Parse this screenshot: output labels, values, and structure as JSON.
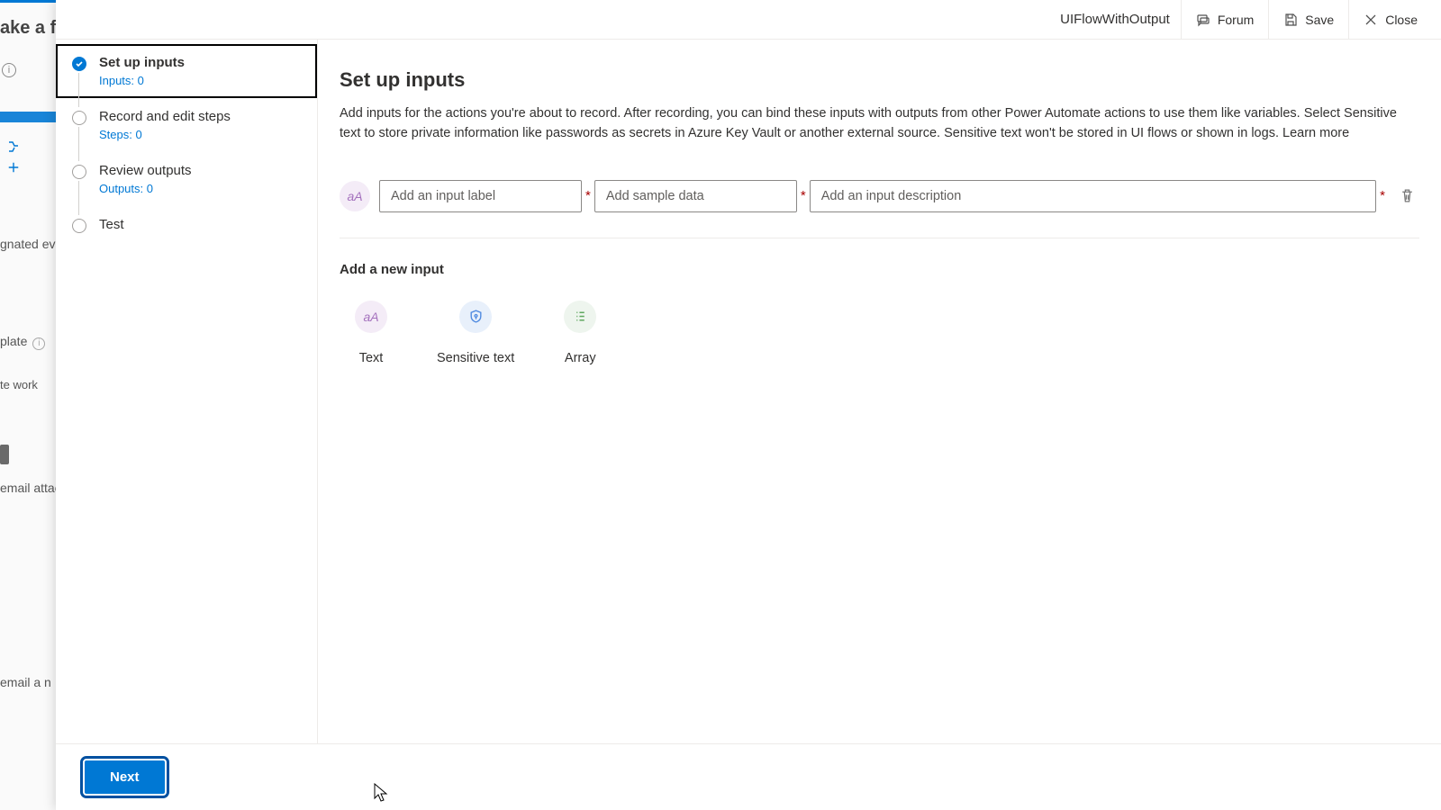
{
  "background": {
    "heading": "ake a fl",
    "items": {
      "gnated": "gnated even",
      "plate": "plate",
      "work": "te work",
      "attach": "email attac",
      "emailn": "email a n"
    }
  },
  "header": {
    "flow_name": "UIFlowWithOutput",
    "forum": "Forum",
    "save": "Save",
    "close": "Close"
  },
  "wizard": {
    "steps": [
      {
        "label": "Set up inputs",
        "sub": "Inputs: 0"
      },
      {
        "label": "Record and edit steps",
        "sub": "Steps: 0"
      },
      {
        "label": "Review outputs",
        "sub": "Outputs: 0"
      },
      {
        "label": "Test",
        "sub": ""
      }
    ]
  },
  "panel": {
    "title": "Set up inputs",
    "description": "Add inputs for the actions you're about to record. After recording, you can bind these inputs with outputs from other Power Automate actions to use them like variables. Select Sensitive text to store private information like passwords as secrets in Azure Key Vault or another external source. Sensitive text won't be stored in UI flows or shown in logs. ",
    "learn_more": "Learn more",
    "input_row": {
      "label_ph": "Add an input label",
      "sample_ph": "Add sample data",
      "desc_ph": "Add an input description"
    },
    "add_new_title": "Add a new input",
    "types": {
      "text": "Text",
      "sensitive": "Sensitive text",
      "array": "Array"
    }
  },
  "footer": {
    "next": "Next"
  }
}
